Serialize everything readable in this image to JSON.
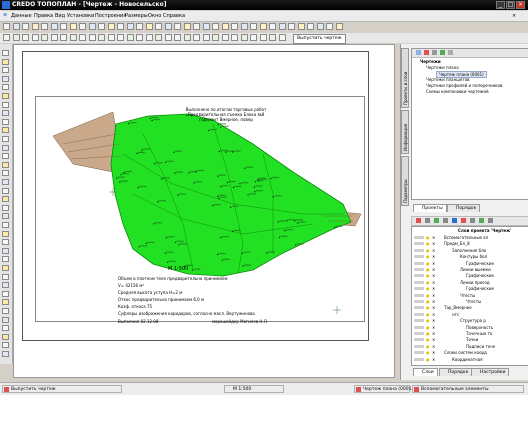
{
  "window": {
    "title": "CREDO ТОПОПЛАН - [Чертеж - Новосельско]",
    "minimize": "_",
    "maximize": "□",
    "close": "×"
  },
  "menu": [
    "Данные",
    "Правка",
    "Вид",
    "Установки",
    "Построения",
    "Размеры",
    "Окно",
    "Справка"
  ],
  "toolbar": {
    "mode_button": "Выпустить чертеж"
  },
  "plan": {
    "title_lines": [
      "Выполнено по итогам торговых работ",
      "Предварительная съемка Блока №8",
      "горизонт Вмерное, повер"
    ],
    "scale": "М 1:500",
    "notes": [
      "Объем в плотном теле предварительно принимаем",
      "V= 42156 м³",
      "Средняя высота уступа Н=2 м",
      "Откос предварительно принимаем 6,0 м",
      "Коэф. откоса 75",
      "Суфлеры изображения коридоров, согласно масл. Вертужинова"
    ],
    "date_line": "Выполнил 02.12.08",
    "author_line": "маркшейдер Могилев Н.Л."
  },
  "side_tabs": {
    "top": "Проекты и слои",
    "middle": "Информация",
    "bottom": "Параметры"
  },
  "drawings_panel": {
    "header": "Чертежи",
    "tree": [
      {
        "label": "Чертежи плана",
        "level": 1
      },
      {
        "label": "Чертеж плана (0001)",
        "level": 2
      },
      {
        "label": "Чертежи планшетов",
        "level": 1
      },
      {
        "label": "Чертежи профилей и поперечников",
        "level": 1
      },
      {
        "label": "Схемы компоновки чертежей",
        "level": 1
      }
    ]
  },
  "mid_tabs": [
    "Проекты",
    "Порядок"
  ],
  "layers_panel": {
    "header": "Слои проекта 'Чертеж'",
    "items": [
      "Вспомогательные эл",
      "Предм_Бл_8",
      "Заполнение бло",
      "Контуры бол",
      "Графические",
      "Линии выемки",
      "Графические",
      "Линии проезд",
      "Графические",
      "Чтесты",
      "Чтесты",
      "Тар_Вмерное",
      "нтс",
      "Структура р",
      "Поверхность",
      "Точечные то",
      "Точки",
      "Подписи точе",
      "Слоеи систем коорд",
      "Координатная"
    ]
  },
  "bottom_tabs": [
    "Слои",
    "Порядок",
    "Настройки"
  ],
  "status": {
    "left": "Выпустить чертеж",
    "scale": "М 1:500",
    "drawing": "Чертеж плана (0001)",
    "elements": "Вспомогательные элементы"
  }
}
